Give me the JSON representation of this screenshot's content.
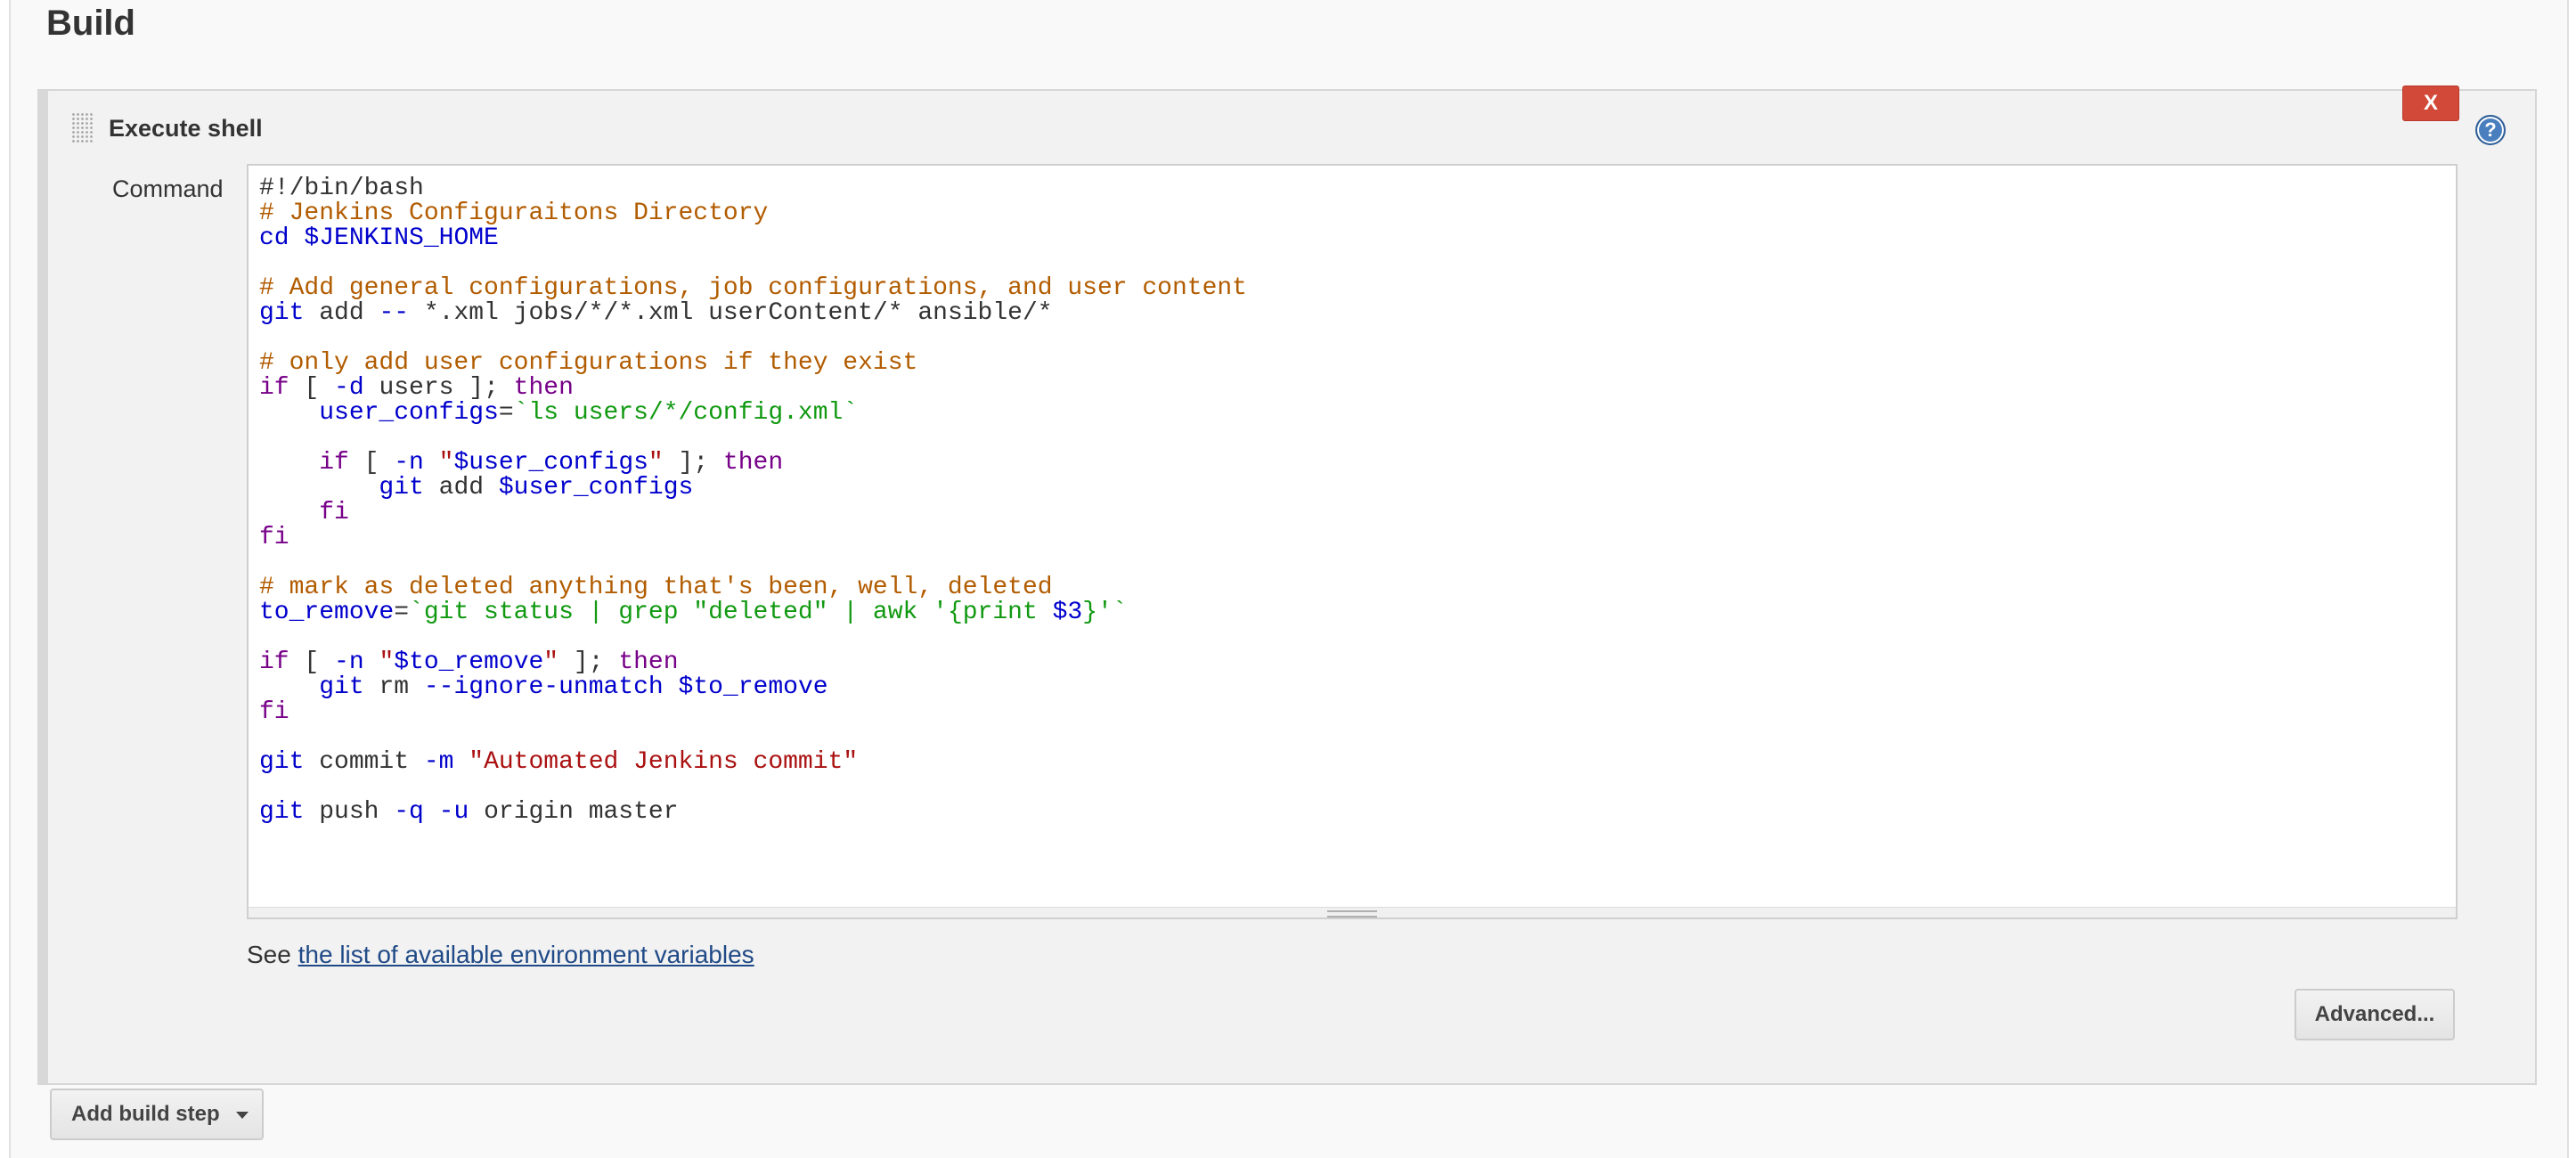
{
  "section": {
    "title": "Build"
  },
  "step": {
    "title": "Execute shell",
    "delete_label": "X",
    "help_icon": "help-icon",
    "command_label": "Command",
    "code_lines": [
      [
        {
          "t": "#!/bin/bash",
          "c": "def"
        }
      ],
      [
        {
          "t": "# Jenkins Configuraitons Directory",
          "c": "comment"
        }
      ],
      [
        {
          "t": "cd ",
          "c": "var"
        },
        {
          "t": "$JENKINS_HOME",
          "c": "var"
        }
      ],
      [],
      [
        {
          "t": "# Add general configurations, job configurations, and user content",
          "c": "comment"
        }
      ],
      [
        {
          "t": "git",
          "c": "var"
        },
        {
          "t": " add ",
          "c": "def"
        },
        {
          "t": "--",
          "c": "var"
        },
        {
          "t": " *.xml jobs/*/*.xml userContent/* ansible/*",
          "c": "def"
        }
      ],
      [],
      [
        {
          "t": "# only add user configurations if they exist",
          "c": "comment"
        }
      ],
      [
        {
          "t": "if",
          "c": "kw"
        },
        {
          "t": " [ ",
          "c": "def"
        },
        {
          "t": "-d",
          "c": "var"
        },
        {
          "t": " users ]; ",
          "c": "def"
        },
        {
          "t": "then",
          "c": "kw"
        }
      ],
      [
        {
          "t": "    ",
          "c": "def"
        },
        {
          "t": "user_configs",
          "c": "var"
        },
        {
          "t": "=",
          "c": "def"
        },
        {
          "t": "`ls users/*/config.xml`",
          "c": "bt"
        }
      ],
      [],
      [
        {
          "t": "    ",
          "c": "def"
        },
        {
          "t": "if",
          "c": "kw"
        },
        {
          "t": " [ ",
          "c": "def"
        },
        {
          "t": "-n",
          "c": "var"
        },
        {
          "t": " ",
          "c": "def"
        },
        {
          "t": "\"",
          "c": "str"
        },
        {
          "t": "$user_configs",
          "c": "var"
        },
        {
          "t": "\"",
          "c": "str"
        },
        {
          "t": " ]; ",
          "c": "def"
        },
        {
          "t": "then",
          "c": "kw"
        }
      ],
      [
        {
          "t": "        ",
          "c": "def"
        },
        {
          "t": "git",
          "c": "var"
        },
        {
          "t": " add ",
          "c": "def"
        },
        {
          "t": "$user_configs",
          "c": "var"
        }
      ],
      [
        {
          "t": "    ",
          "c": "def"
        },
        {
          "t": "fi",
          "c": "kw"
        }
      ],
      [
        {
          "t": "fi",
          "c": "kw"
        }
      ],
      [],
      [
        {
          "t": "# mark as deleted anything that's been, well, deleted",
          "c": "comment"
        }
      ],
      [
        {
          "t": "to_remove",
          "c": "var"
        },
        {
          "t": "=",
          "c": "def"
        },
        {
          "t": "`git status | grep \"deleted\" | awk '{print ",
          "c": "bt"
        },
        {
          "t": "$3",
          "c": "var"
        },
        {
          "t": "}'`",
          "c": "bt"
        }
      ],
      [],
      [
        {
          "t": "if",
          "c": "kw"
        },
        {
          "t": " [ ",
          "c": "def"
        },
        {
          "t": "-n",
          "c": "var"
        },
        {
          "t": " ",
          "c": "def"
        },
        {
          "t": "\"",
          "c": "str"
        },
        {
          "t": "$to_remove",
          "c": "var"
        },
        {
          "t": "\"",
          "c": "str"
        },
        {
          "t": " ]; ",
          "c": "def"
        },
        {
          "t": "then",
          "c": "kw"
        }
      ],
      [
        {
          "t": "    ",
          "c": "def"
        },
        {
          "t": "git",
          "c": "var"
        },
        {
          "t": " rm ",
          "c": "def"
        },
        {
          "t": "--ignore-unmatch",
          "c": "var"
        },
        {
          "t": " ",
          "c": "def"
        },
        {
          "t": "$to_remove",
          "c": "var"
        }
      ],
      [
        {
          "t": "fi",
          "c": "kw"
        }
      ],
      [],
      [
        {
          "t": "git",
          "c": "var"
        },
        {
          "t": " commit ",
          "c": "def"
        },
        {
          "t": "-m",
          "c": "var"
        },
        {
          "t": " ",
          "c": "def"
        },
        {
          "t": "\"Automated Jenkins commit\"",
          "c": "str"
        }
      ],
      [],
      [
        {
          "t": "git",
          "c": "var"
        },
        {
          "t": " push ",
          "c": "def"
        },
        {
          "t": "-q",
          "c": "var"
        },
        {
          "t": " ",
          "c": "def"
        },
        {
          "t": "-u",
          "c": "var"
        },
        {
          "t": " origin master",
          "c": "def"
        }
      ]
    ],
    "env_prefix": "See ",
    "env_link": "the list of available environment variables",
    "advanced_label": "Advanced..."
  },
  "add_step_label": "Add build step",
  "colors": {
    "comment": "#b25c00",
    "keyword": "#770088",
    "variable": "#0000cc",
    "string": "#aa1111",
    "backtick": "#119911",
    "delete": "#d24939"
  }
}
